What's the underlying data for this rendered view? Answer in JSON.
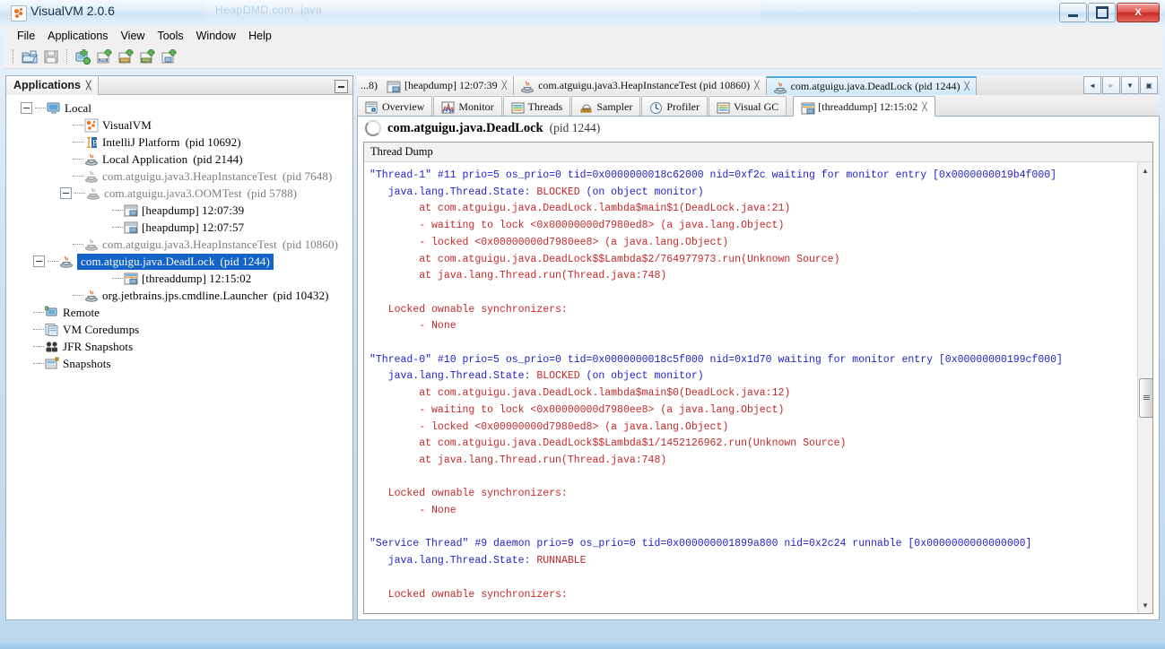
{
  "window": {
    "title": "VisualVM 2.0.6",
    "ghost_title": "HeapDMD.com  .java",
    "app_icon": "visualvm-icon",
    "buttons": {
      "minimize": "minimize-button",
      "maximize": "maximize-button",
      "close": "X"
    }
  },
  "menubar": {
    "items": [
      "File",
      "Applications",
      "View",
      "Tools",
      "Window",
      "Help"
    ]
  },
  "toolbar": {
    "buttons": [
      {
        "name": "open-snapshot-button",
        "icon": "folder-open-icon"
      },
      {
        "name": "save-snapshot-button",
        "icon": "floppy-save-icon"
      },
      {
        "name": "add-remote-host-button",
        "icon": "add-host-icon"
      },
      {
        "name": "add-jmx-connection-button",
        "icon": "add-jmx-icon"
      },
      {
        "name": "add-vm-coredump-button",
        "icon": "add-coredump-icon"
      },
      {
        "name": "add-jfr-snapshot-button",
        "icon": "add-jfr-icon"
      },
      {
        "name": "add-snapshot-button",
        "icon": "add-snapshot-icon"
      }
    ]
  },
  "applications_panel": {
    "tab_label": "Applications",
    "close_glyph": "╳",
    "minimize": "minimize-panel-button",
    "tree": [
      {
        "indent": 0,
        "expander": "minus",
        "icon": "computer-icon",
        "label": "Local",
        "pid": "",
        "dim": false,
        "selected": false
      },
      {
        "indent": 1,
        "expander": "none",
        "icon": "visualvm-icon",
        "label": "VisualVM",
        "pid": "",
        "dim": false,
        "selected": false
      },
      {
        "indent": 1,
        "expander": "none",
        "icon": "intellij-icon",
        "label": "IntelliJ Platform",
        "pid": "(pid 10692)",
        "dim": false,
        "selected": false
      },
      {
        "indent": 1,
        "expander": "none",
        "icon": "java-icon",
        "label": "Local Application",
        "pid": "(pid 2144)",
        "dim": false,
        "selected": false
      },
      {
        "indent": 1,
        "expander": "none",
        "icon": "java-gray-icon",
        "label": "com.atguigu.java3.HeapInstanceTest",
        "pid": "(pid 7648)",
        "dim": true,
        "selected": false
      },
      {
        "indent": 1,
        "expander": "minus",
        "icon": "java-gray-icon",
        "label": "com.atguigu.java3.OOMTest",
        "pid": "(pid 5788)",
        "dim": true,
        "selected": false
      },
      {
        "indent": 2,
        "expander": "none",
        "icon": "heapdump-icon",
        "label": "[heapdump] 12:07:39",
        "pid": "",
        "dim": false,
        "selected": false
      },
      {
        "indent": 2,
        "expander": "none",
        "icon": "heapdump-icon",
        "label": "[heapdump] 12:07:57",
        "pid": "",
        "dim": false,
        "selected": false
      },
      {
        "indent": 1,
        "expander": "none",
        "icon": "java-gray-icon",
        "label": "com.atguigu.java3.HeapInstanceTest",
        "pid": "(pid 10860)",
        "dim": true,
        "selected": false
      },
      {
        "indent": 1,
        "expander": "minus",
        "icon": "java-icon",
        "label": "com.atguigu.java.DeadLock",
        "pid": "(pid 1244)",
        "dim": false,
        "selected": true
      },
      {
        "indent": 2,
        "expander": "none",
        "icon": "threaddump-icon",
        "label": "[threaddump] 12:15:02",
        "pid": "",
        "dim": false,
        "selected": false
      },
      {
        "indent": 1,
        "expander": "none",
        "icon": "java-icon",
        "label": "org.jetbrains.jps.cmdline.Launcher",
        "pid": "(pid 10432)",
        "dim": false,
        "selected": false
      },
      {
        "indent": 0,
        "expander": "none",
        "icon": "remote-icon",
        "label": "Remote",
        "pid": "",
        "dim": false,
        "selected": false
      },
      {
        "indent": 0,
        "expander": "none",
        "icon": "coredump-icon",
        "label": "VM Coredumps",
        "pid": "",
        "dim": false,
        "selected": false
      },
      {
        "indent": 0,
        "expander": "none",
        "icon": "jfr-icon",
        "label": "JFR Snapshots",
        "pid": "",
        "dim": false,
        "selected": false
      },
      {
        "indent": 0,
        "expander": "none",
        "icon": "snapshots-icon",
        "label": "Snapshots",
        "pid": "",
        "dim": false,
        "selected": false
      }
    ]
  },
  "document_tabs": {
    "tabs": [
      {
        "label": "...8)",
        "icon": "",
        "active": false,
        "closable": false,
        "partial": true
      },
      {
        "label": "[heapdump] 12:07:39",
        "icon": "heapdump-icon",
        "active": false,
        "closable": true,
        "partial": false
      },
      {
        "label": "com.atguigu.java3.HeapInstanceTest (pid 10860)",
        "icon": "java-icon",
        "active": false,
        "closable": true,
        "partial": false
      },
      {
        "label": "com.atguigu.java.DeadLock (pid 1244)",
        "icon": "java-icon",
        "active": true,
        "closable": true,
        "partial": false
      }
    ],
    "nav": {
      "prev": "◄",
      "next": "►",
      "list": "▼",
      "maximize": "▣"
    }
  },
  "sub_tabs": [
    {
      "label": "Overview",
      "icon": "overview-icon",
      "active": false
    },
    {
      "label": "Monitor",
      "icon": "monitor-icon",
      "active": false
    },
    {
      "label": "Threads",
      "icon": "threads-icon",
      "active": false
    },
    {
      "label": "Sampler",
      "icon": "sampler-icon",
      "active": false
    },
    {
      "label": "Profiler",
      "icon": "profiler-icon",
      "active": false
    },
    {
      "label": "Visual GC",
      "icon": "visualgc-icon",
      "active": false
    },
    {
      "label": "[threaddump] 12:15:02",
      "icon": "threaddump-icon",
      "active": true,
      "closable": true
    }
  ],
  "content": {
    "title_main": "com.atguigu.java.DeadLock",
    "title_pid": "(pid 1244)",
    "dump_label": "Thread Dump",
    "lines": [
      {
        "type": "hdr",
        "text": "\"Thread-1\" #11 prio=5 os_prio=0 tid=0x0000000018c62000 nid=0xf2c waiting for monitor entry [0x0000000019b4f000]"
      },
      {
        "type": "state",
        "key": "   java.lang.Thread.State: ",
        "value": "BLOCKED",
        "tail": " (on object monitor)"
      },
      {
        "type": "body",
        "text": "        at com.atguigu.java.DeadLock.lambda$main$1(DeadLock.java:21)"
      },
      {
        "type": "body",
        "text": "        - waiting to lock <0x00000000d7980ed8> (a java.lang.Object)"
      },
      {
        "type": "body",
        "text": "        - locked <0x00000000d7980ee8> (a java.lang.Object)"
      },
      {
        "type": "body",
        "text": "        at com.atguigu.java.DeadLock$$Lambda$2/764977973.run(Unknown Source)"
      },
      {
        "type": "body",
        "text": "        at java.lang.Thread.run(Thread.java:748)"
      },
      {
        "type": "blank",
        "text": ""
      },
      {
        "type": "body",
        "text": "   Locked ownable synchronizers:"
      },
      {
        "type": "body",
        "text": "        - None"
      },
      {
        "type": "blank",
        "text": ""
      },
      {
        "type": "hdr",
        "text": "\"Thread-0\" #10 prio=5 os_prio=0 tid=0x0000000018c5f000 nid=0x1d70 waiting for monitor entry [0x00000000199cf000]"
      },
      {
        "type": "state",
        "key": "   java.lang.Thread.State: ",
        "value": "BLOCKED",
        "tail": " (on object monitor)"
      },
      {
        "type": "body",
        "text": "        at com.atguigu.java.DeadLock.lambda$main$0(DeadLock.java:12)"
      },
      {
        "type": "body",
        "text": "        - waiting to lock <0x00000000d7980ee8> (a java.lang.Object)"
      },
      {
        "type": "body",
        "text": "        - locked <0x00000000d7980ed8> (a java.lang.Object)"
      },
      {
        "type": "body",
        "text": "        at com.atguigu.java.DeadLock$$Lambda$1/1452126962.run(Unknown Source)"
      },
      {
        "type": "body",
        "text": "        at java.lang.Thread.run(Thread.java:748)"
      },
      {
        "type": "blank",
        "text": ""
      },
      {
        "type": "body",
        "text": "   Locked ownable synchronizers:"
      },
      {
        "type": "body",
        "text": "        - None"
      },
      {
        "type": "blank",
        "text": ""
      },
      {
        "type": "hdr",
        "text": "\"Service Thread\" #9 daemon prio=9 os_prio=0 tid=0x000000001899a800 nid=0x2c24 runnable [0x0000000000000000]"
      },
      {
        "type": "state",
        "key": "   java.lang.Thread.State: ",
        "value": "RUNNABLE",
        "tail": ""
      },
      {
        "type": "blank",
        "text": ""
      },
      {
        "type": "body",
        "text": "   Locked ownable synchronizers:"
      }
    ]
  },
  "colors": {
    "header_text": "#2222cc",
    "body_text": "#c62828",
    "selection": "#1464c8",
    "tab_active": "#cfe9f8"
  }
}
